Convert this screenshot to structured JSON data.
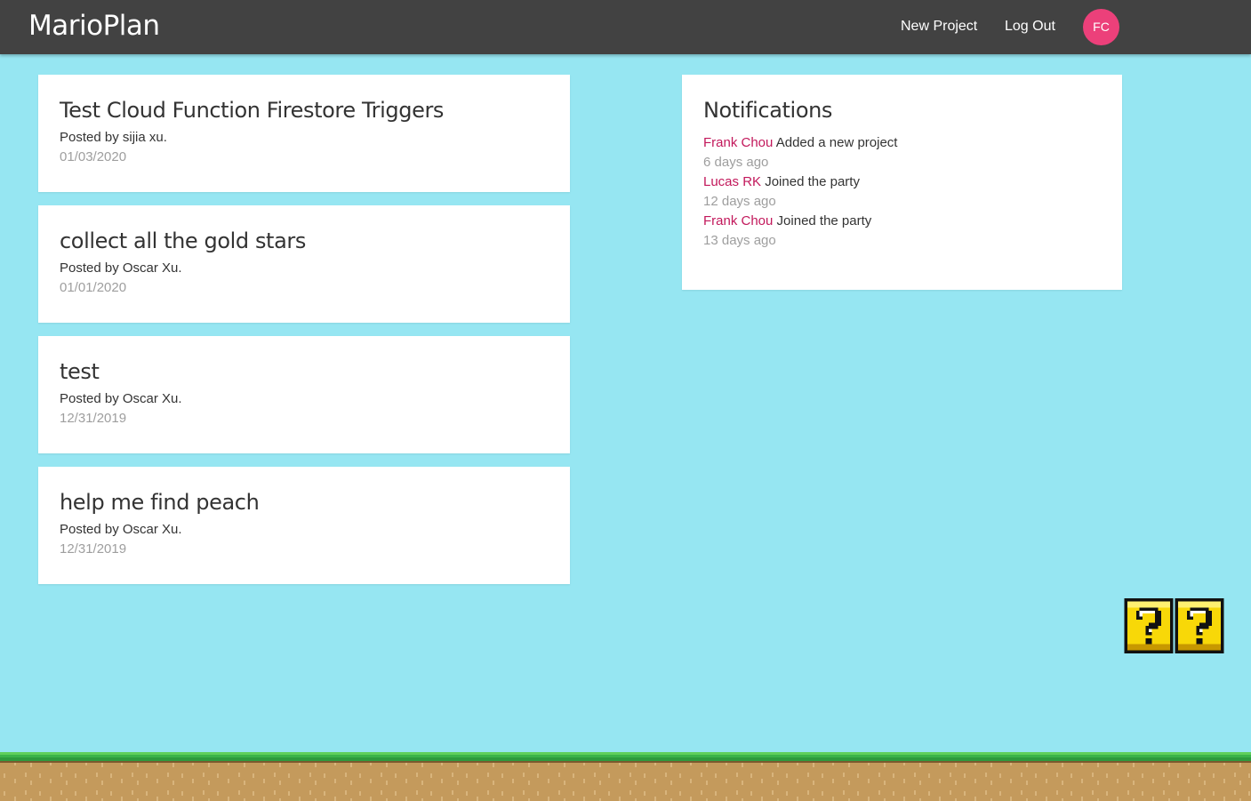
{
  "navbar": {
    "brand": "MarioPlan",
    "links": [
      "New Project",
      "Log Out"
    ],
    "avatar_initials": "FC",
    "avatar_color": "#ec407a",
    "background": "#424242"
  },
  "projects": [
    {
      "title": "Test Cloud Function Firestore Triggers",
      "author": "Posted by sijia xu.",
      "date": "01/03/2020"
    },
    {
      "title": "collect all the gold stars",
      "author": "Posted by Oscar Xu.",
      "date": "01/01/2020"
    },
    {
      "title": "test",
      "author": "Posted by Oscar Xu.",
      "date": "12/31/2019"
    },
    {
      "title": "help me find peach",
      "author": "Posted by Oscar Xu.",
      "date": "12/31/2019"
    }
  ],
  "notifications": {
    "title": "Notifications",
    "items": [
      {
        "user": "Frank Chou",
        "content": "Added a new project",
        "time": "6 days ago"
      },
      {
        "user": "Lucas RK",
        "content": "Joined the party",
        "time": "12 days ago"
      },
      {
        "user": "Frank Chou",
        "content": "Joined the party",
        "time": "13 days ago"
      }
    ]
  },
  "decor": {
    "question_block_icon": "question-block-icon",
    "ground_icon": "grass-ground-icon",
    "sky_color": "#96e6f2"
  }
}
